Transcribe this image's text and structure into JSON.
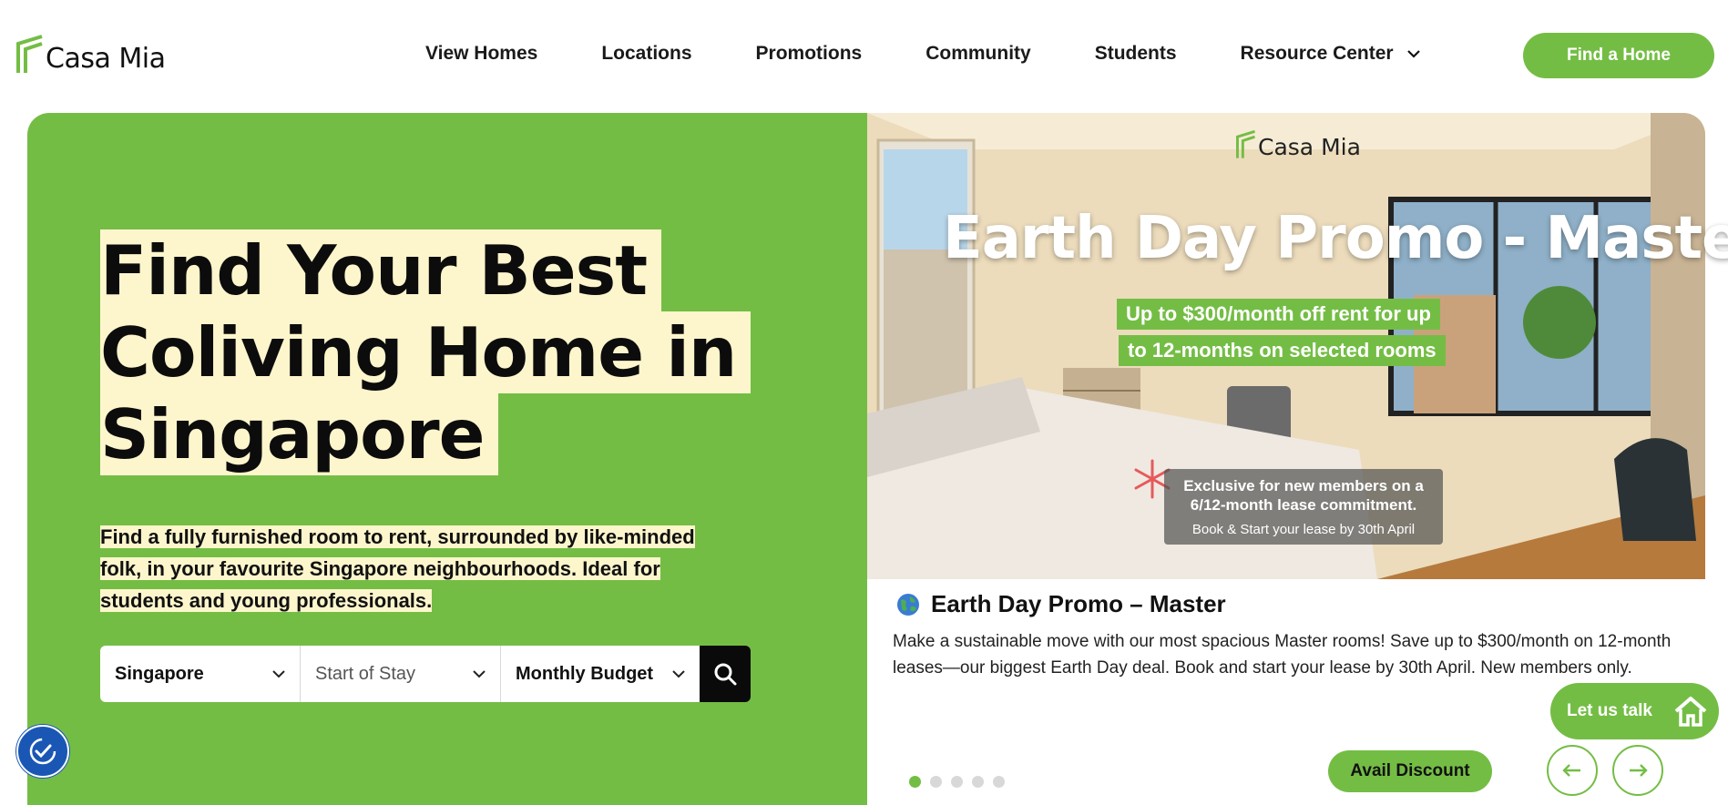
{
  "brand": {
    "name": "Casa Mia",
    "accent": "#74bd45",
    "highlight": "#fdf6cc"
  },
  "nav": {
    "items": [
      "View Homes",
      "Locations",
      "Promotions",
      "Community",
      "Students",
      "Resource Center"
    ],
    "cta": "Find a Home"
  },
  "hero": {
    "headline_lines": [
      "Find Your Best",
      "Coliving Home in",
      "Singapore"
    ],
    "sub_lines": [
      "Find a fully furnished room to rent, surrounded by like-minded",
      "folk, in your favourite Singapore neighbourhoods. Ideal for",
      "students and young professionals."
    ],
    "search": {
      "location": "Singapore",
      "start": "Start of Stay",
      "budget": "Monthly Budget"
    }
  },
  "banner": {
    "logo": "Casa Mia",
    "title": "Earth Day Promo - Master",
    "pill1": "Up to $300/month off rent for up",
    "pill2": "to 12-months on selected rooms",
    "note_bold1": "Exclusive for new members on a",
    "note_bold2": "6/12-month lease commitment.",
    "note_small": "Book & Start your lease by 30th April"
  },
  "card": {
    "icon": "earth-globe-icon",
    "title": "Earth Day Promo – Master",
    "desc": "Make a sustainable move with our most spacious Master rooms! Save up to $300/month on 12-month leases—our biggest Earth Day deal. Book and start your lease by 30th April. New members only.",
    "button": "Avail Discount",
    "slides": 5,
    "active_slide": 1
  },
  "chat": {
    "label": "Let us talk"
  }
}
